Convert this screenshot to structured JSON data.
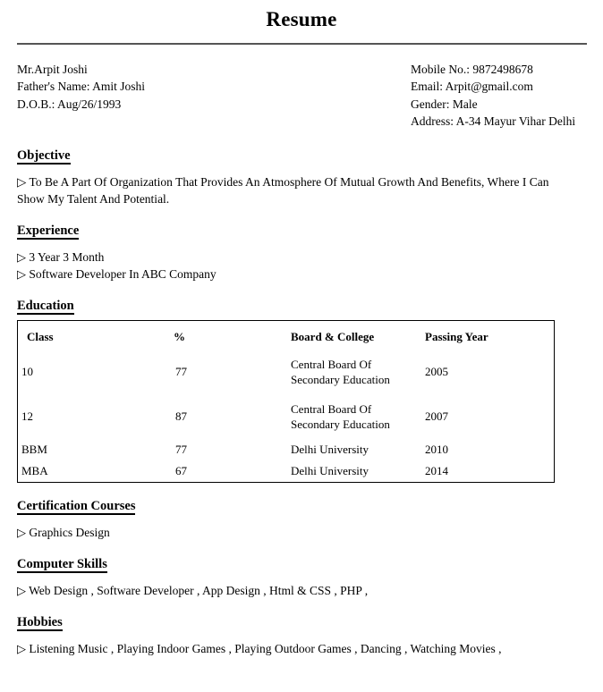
{
  "document": {
    "title": "Resume"
  },
  "personal": {
    "left": [
      "Mr.Arpit Joshi",
      "Father's Name: Amit Joshi",
      "D.O.B.: Aug/26/1993"
    ],
    "right": [
      "Mobile No.: 9872498678",
      "Email: Arpit@gmail.com",
      "Gender: Male",
      "Address: A-34 Mayur Vihar Delhi"
    ]
  },
  "bullet_glyph": "▷",
  "sections": {
    "objective": {
      "heading": "Objective",
      "text": "To Be A Part Of Organization That Provides An Atmosphere Of Mutual Growth And Benefits, Where I Can Show My Talent And Potential."
    },
    "experience": {
      "heading": "Experience",
      "items": [
        "3 Year 3 Month",
        "Software Developer In ABC Company"
      ]
    },
    "education": {
      "heading": "Education",
      "table": {
        "columns": [
          "Class",
          "%",
          "Board & College",
          "Passing Year"
        ],
        "rows": [
          {
            "class": "10",
            "percent": "77",
            "board_line1": "Central Board Of",
            "board_line2": "Secondary Education",
            "year": "2005"
          },
          {
            "class": "12",
            "percent": "87",
            "board_line1": "Central Board Of",
            "board_line2": "Secondary Education",
            "year": "2007"
          },
          {
            "class": "BBM",
            "percent": "77",
            "board_line1": "Delhi University",
            "board_line2": "",
            "year": "2010"
          },
          {
            "class": "MBA",
            "percent": "67",
            "board_line1": "Delhi University",
            "board_line2": "",
            "year": "2014"
          }
        ]
      }
    },
    "certification": {
      "heading": "Certification Courses",
      "items": [
        " Graphics Design"
      ]
    },
    "computer_skills": {
      "heading": "Computer Skills",
      "items": [
        "Web Design , Software Developer , App Design , Html & CSS , PHP ,"
      ]
    },
    "hobbies": {
      "heading": "Hobbies",
      "items": [
        "Listening Music , Playing Indoor Games , Playing Outdoor Games , Dancing , Watching Movies ,"
      ]
    }
  }
}
